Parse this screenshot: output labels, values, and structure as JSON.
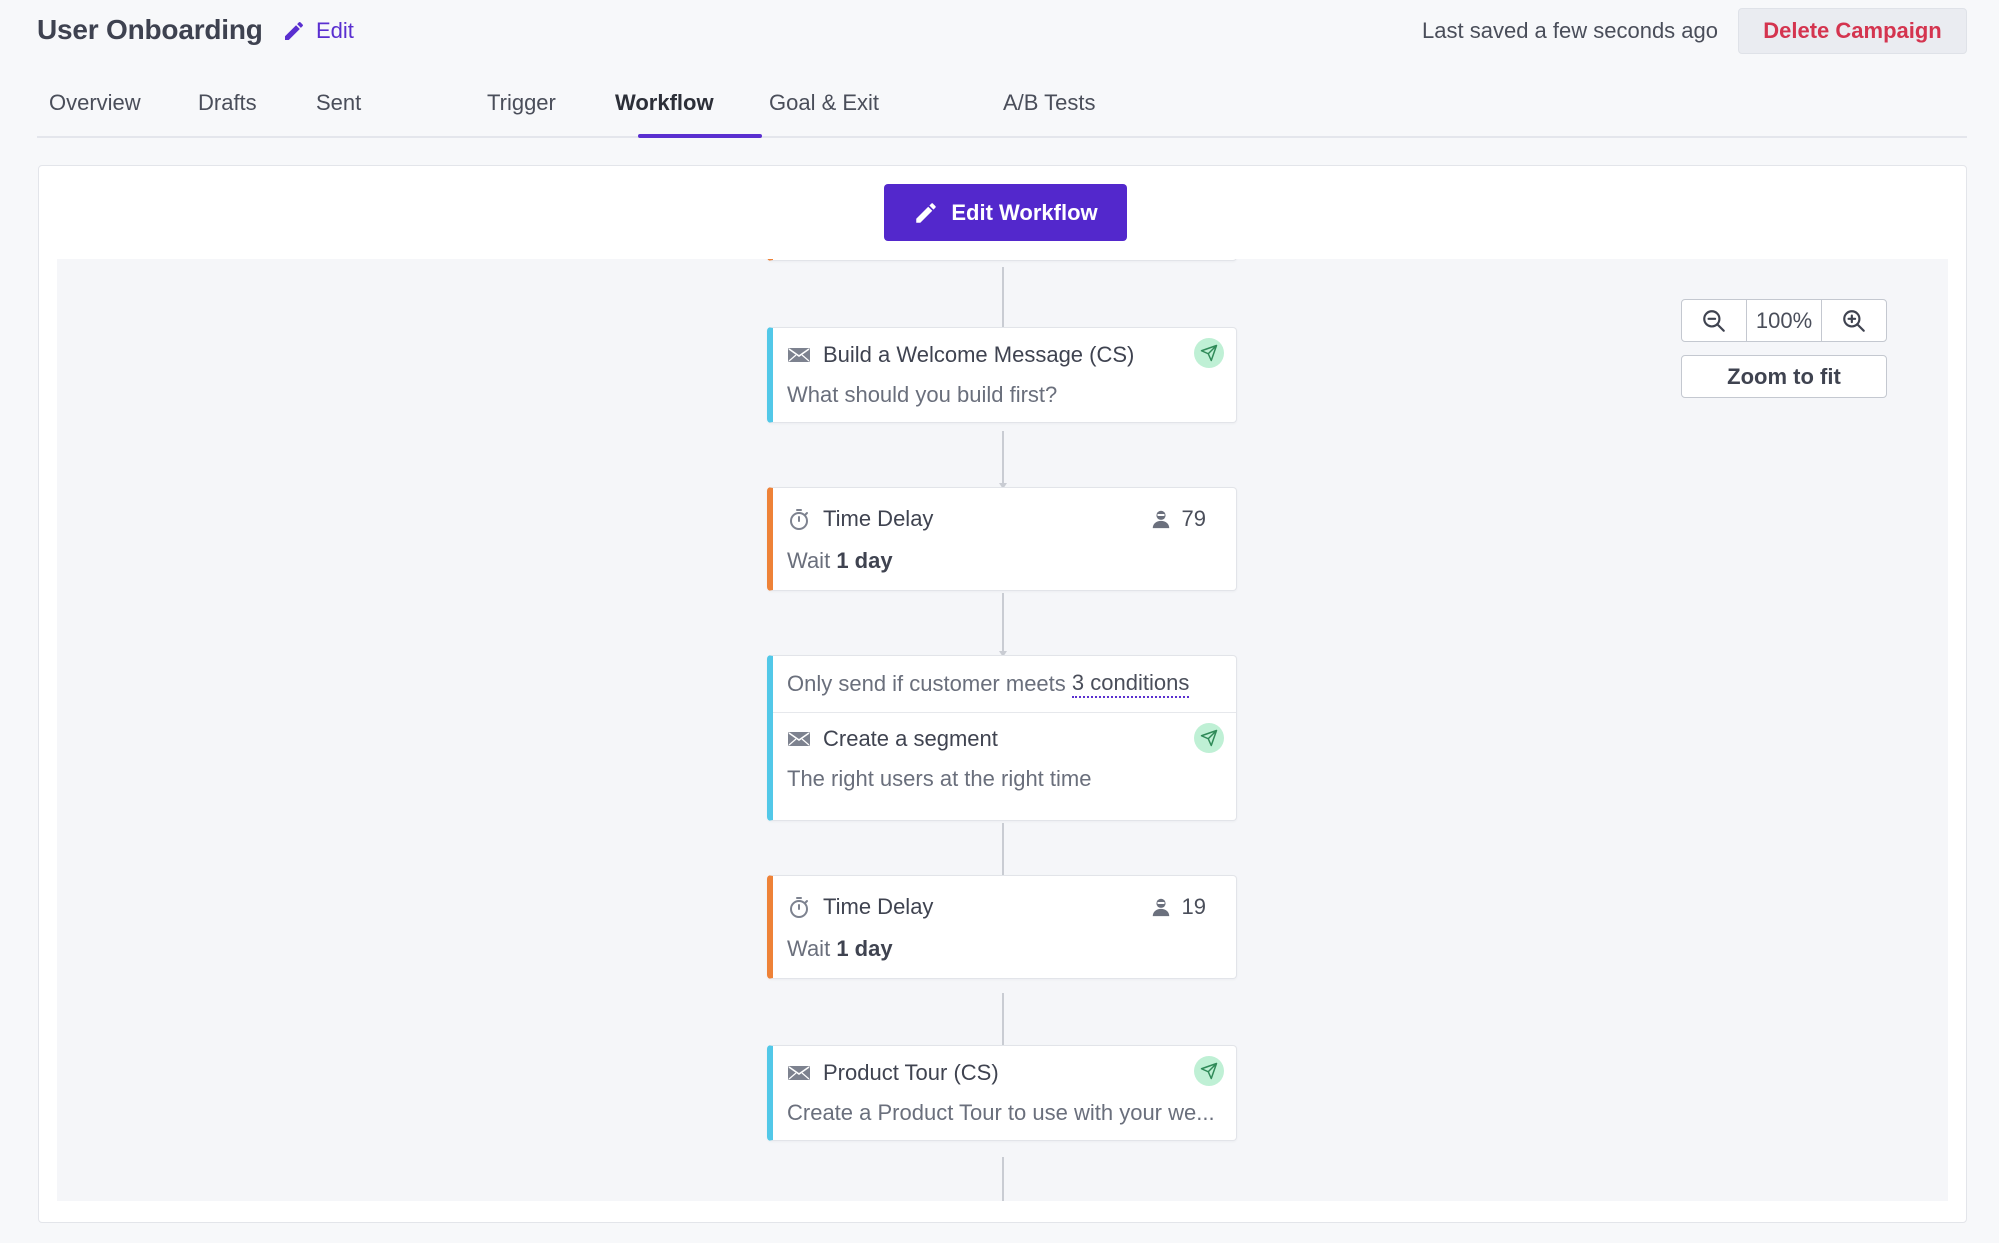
{
  "header": {
    "title": "User Onboarding",
    "edit_label": "Edit",
    "saved_status": "Last saved a few seconds ago",
    "delete_label": "Delete Campaign"
  },
  "tabs": [
    {
      "label": "Overview",
      "active": false
    },
    {
      "label": "Drafts",
      "active": false
    },
    {
      "label": "Sent",
      "active": false
    },
    {
      "label": "Trigger",
      "active": false
    },
    {
      "label": "Workflow",
      "active": true
    },
    {
      "label": "Goal & Exit",
      "active": false
    },
    {
      "label": "A/B Tests",
      "active": false
    }
  ],
  "toolbar": {
    "edit_workflow_label": "Edit Workflow"
  },
  "zoom": {
    "level": "100%",
    "fit_label": "Zoom to fit"
  },
  "workflow": {
    "nodes": [
      {
        "type": "email",
        "icon": "envelope-icon",
        "title": "Build a Welcome Message (CS)",
        "subtitle": "What should you build first?",
        "status_icon": "send-icon"
      },
      {
        "type": "delay",
        "icon": "stopwatch-icon",
        "title": "Time Delay",
        "wait_prefix": "Wait",
        "wait_value": "1 day",
        "count": "79"
      },
      {
        "type": "email",
        "icon": "envelope-icon",
        "condition_prefix": "Only send if customer meets",
        "condition_link": "3 conditions",
        "title": "Create a segment",
        "subtitle": "The right users at the right time",
        "status_icon": "send-icon"
      },
      {
        "type": "delay",
        "icon": "stopwatch-icon",
        "title": "Time Delay",
        "wait_prefix": "Wait",
        "wait_value": "1 day",
        "count": "19"
      },
      {
        "type": "email",
        "icon": "envelope-icon",
        "title": "Product Tour (CS)",
        "subtitle": "Create a Product Tour to use with your we...",
        "status_icon": "send-icon"
      }
    ]
  },
  "colors": {
    "accent": "#5328cc",
    "danger": "#d4344f",
    "email_bar": "#52c8e8",
    "delay_bar": "#ee8238",
    "sent_badge": "#bff0d5"
  }
}
